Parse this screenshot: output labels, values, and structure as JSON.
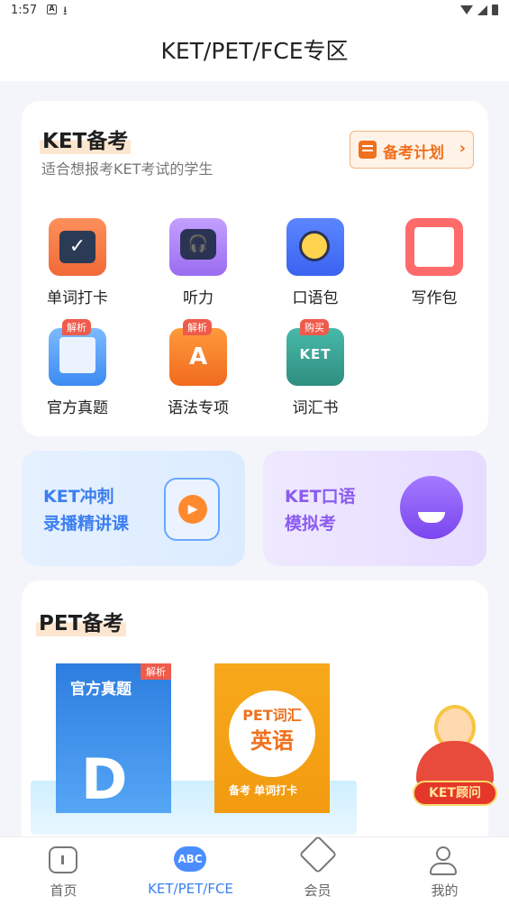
{
  "status_bar": {
    "time": "1:57",
    "notif1": "A",
    "notif2": "⭳"
  },
  "header": {
    "title": "KET/PET/FCE专区"
  },
  "ket": {
    "title": "KET备考",
    "subtitle": "适合想报考KET考试的学生",
    "plan_button": {
      "label": "备考计划",
      "chevron": "›"
    },
    "items": [
      {
        "label": "单词打卡",
        "icon": "calendar-check-icon"
      },
      {
        "label": "听力",
        "icon": "headphones-icon"
      },
      {
        "label": "口语包",
        "icon": "speaking-face-icon"
      },
      {
        "label": "写作包",
        "icon": "notepad-pencil-icon"
      },
      {
        "label": "官方真题",
        "icon": "open-book-icon",
        "badge": "解析"
      },
      {
        "label": "语法专项",
        "icon": "grammar-book-icon",
        "badge": "解析"
      },
      {
        "label": "词汇书",
        "icon": "ket-book-icon",
        "badge": "购买"
      }
    ]
  },
  "promos": [
    {
      "line1": "KET冲刺",
      "line2": "录播精讲课",
      "icon": "tv-play-icon"
    },
    {
      "line1": "KET口语",
      "line2": "模拟考",
      "icon": "winking-face-icon"
    }
  ],
  "pet": {
    "title": "PET备考",
    "books": [
      {
        "title": "官方真题",
        "letter": "D",
        "badge": "解析"
      },
      {
        "title_top": "PET词汇",
        "title_main": "英语",
        "footer": "备考 单词打卡"
      }
    ]
  },
  "advisor": {
    "label": "KET顾问"
  },
  "tabs": [
    {
      "label": "首页",
      "icon": "home-icon"
    },
    {
      "label": "KET/PET/FCE",
      "icon_text": "ABC",
      "active": true
    },
    {
      "label": "会员",
      "icon": "diamond-icon"
    },
    {
      "label": "我的",
      "icon": "profile-icon"
    }
  ],
  "colors": {
    "accent": "#3c7ff0",
    "orange": "#f0701e",
    "badge": "#ef5b4b"
  }
}
